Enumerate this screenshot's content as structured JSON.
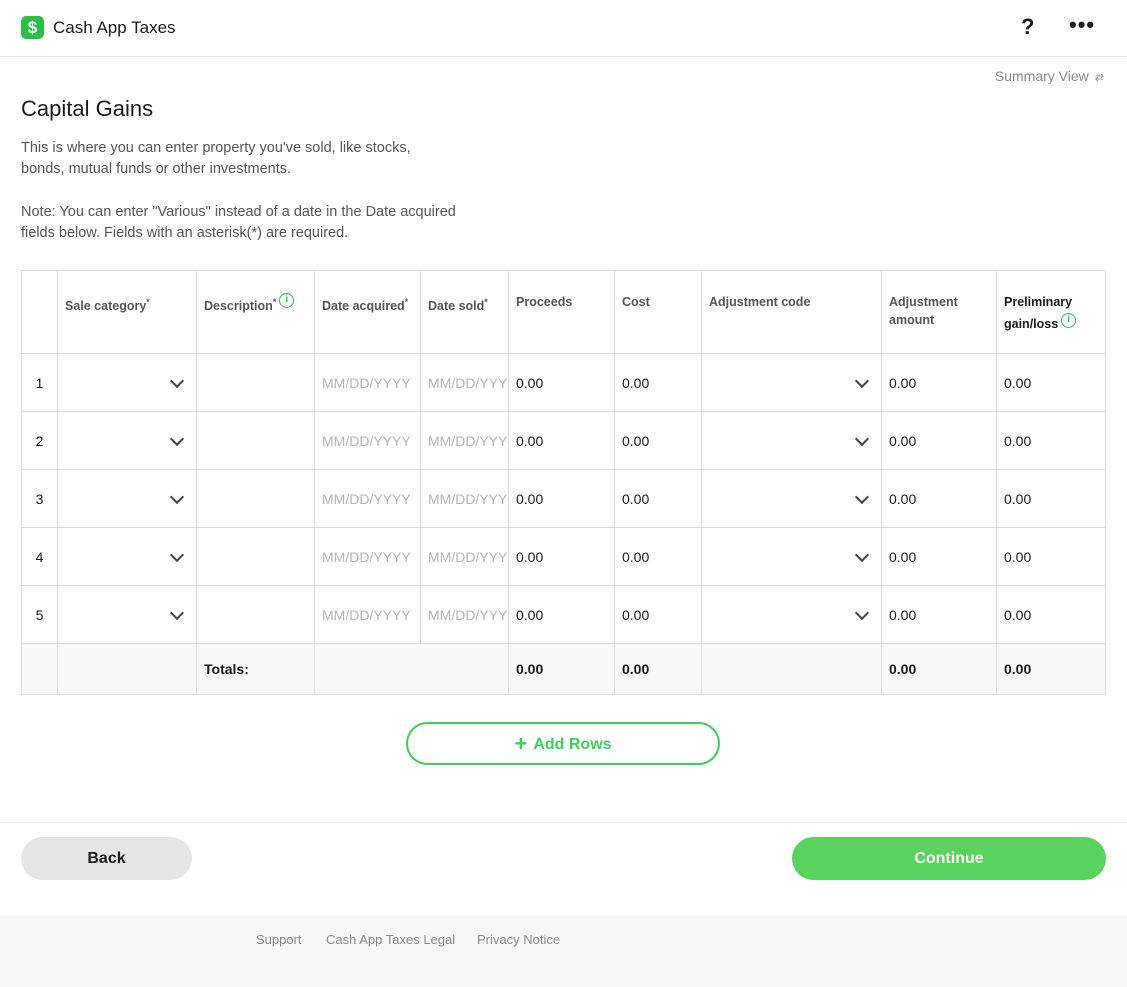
{
  "app": {
    "title": "Cash App Taxes",
    "logo_glyph": "$",
    "brand_color": "#2bbf4a",
    "accent_color": "#5ad25f"
  },
  "header": {
    "help_glyph": "?",
    "more_glyph": "•••"
  },
  "summary_view": {
    "label": "Summary View",
    "icon_glyph": "⇄"
  },
  "page": {
    "title": "Capital Gains",
    "intro": "This is where you can enter property you've sold, like stocks, bonds, mutual funds or other investments.",
    "note": "Note: You can enter \"Various\" instead of a date in the Date acquired fields below. Fields with an asterisk(*) are required."
  },
  "table": {
    "columns": {
      "sale_category": "Sale category",
      "description": "Description",
      "date_acquired": "Date acquired",
      "date_sold": "Date sold",
      "proceeds": "Proceeds",
      "cost": "Cost",
      "adjustment_code": "Adjustment code",
      "adjustment_amount": "Adjustment amount",
      "preliminary": "Preliminary",
      "gain_loss": "gain/loss",
      "required_mark": "*",
      "info_glyph": "i"
    },
    "date_placeholder": "MM/DD/YYYY",
    "rows": [
      {
        "num": "1",
        "proceeds": "0.00",
        "cost": "0.00",
        "adj_amount": "0.00",
        "gain": "0.00"
      },
      {
        "num": "2",
        "proceeds": "0.00",
        "cost": "0.00",
        "adj_amount": "0.00",
        "gain": "0.00"
      },
      {
        "num": "3",
        "proceeds": "0.00",
        "cost": "0.00",
        "adj_amount": "0.00",
        "gain": "0.00"
      },
      {
        "num": "4",
        "proceeds": "0.00",
        "cost": "0.00",
        "adj_amount": "0.00",
        "gain": "0.00"
      },
      {
        "num": "5",
        "proceeds": "0.00",
        "cost": "0.00",
        "adj_amount": "0.00",
        "gain": "0.00"
      }
    ],
    "totals": {
      "label": "Totals:",
      "proceeds": "0.00",
      "cost": "0.00",
      "adj_amount": "0.00",
      "gain": "0.00"
    }
  },
  "buttons": {
    "add_rows": "Add Rows",
    "add_glyph": "+",
    "back": "Back",
    "continue": "Continue"
  },
  "footer": {
    "support": "Support",
    "legal": "Cash App Taxes Legal",
    "privacy": "Privacy Notice"
  }
}
